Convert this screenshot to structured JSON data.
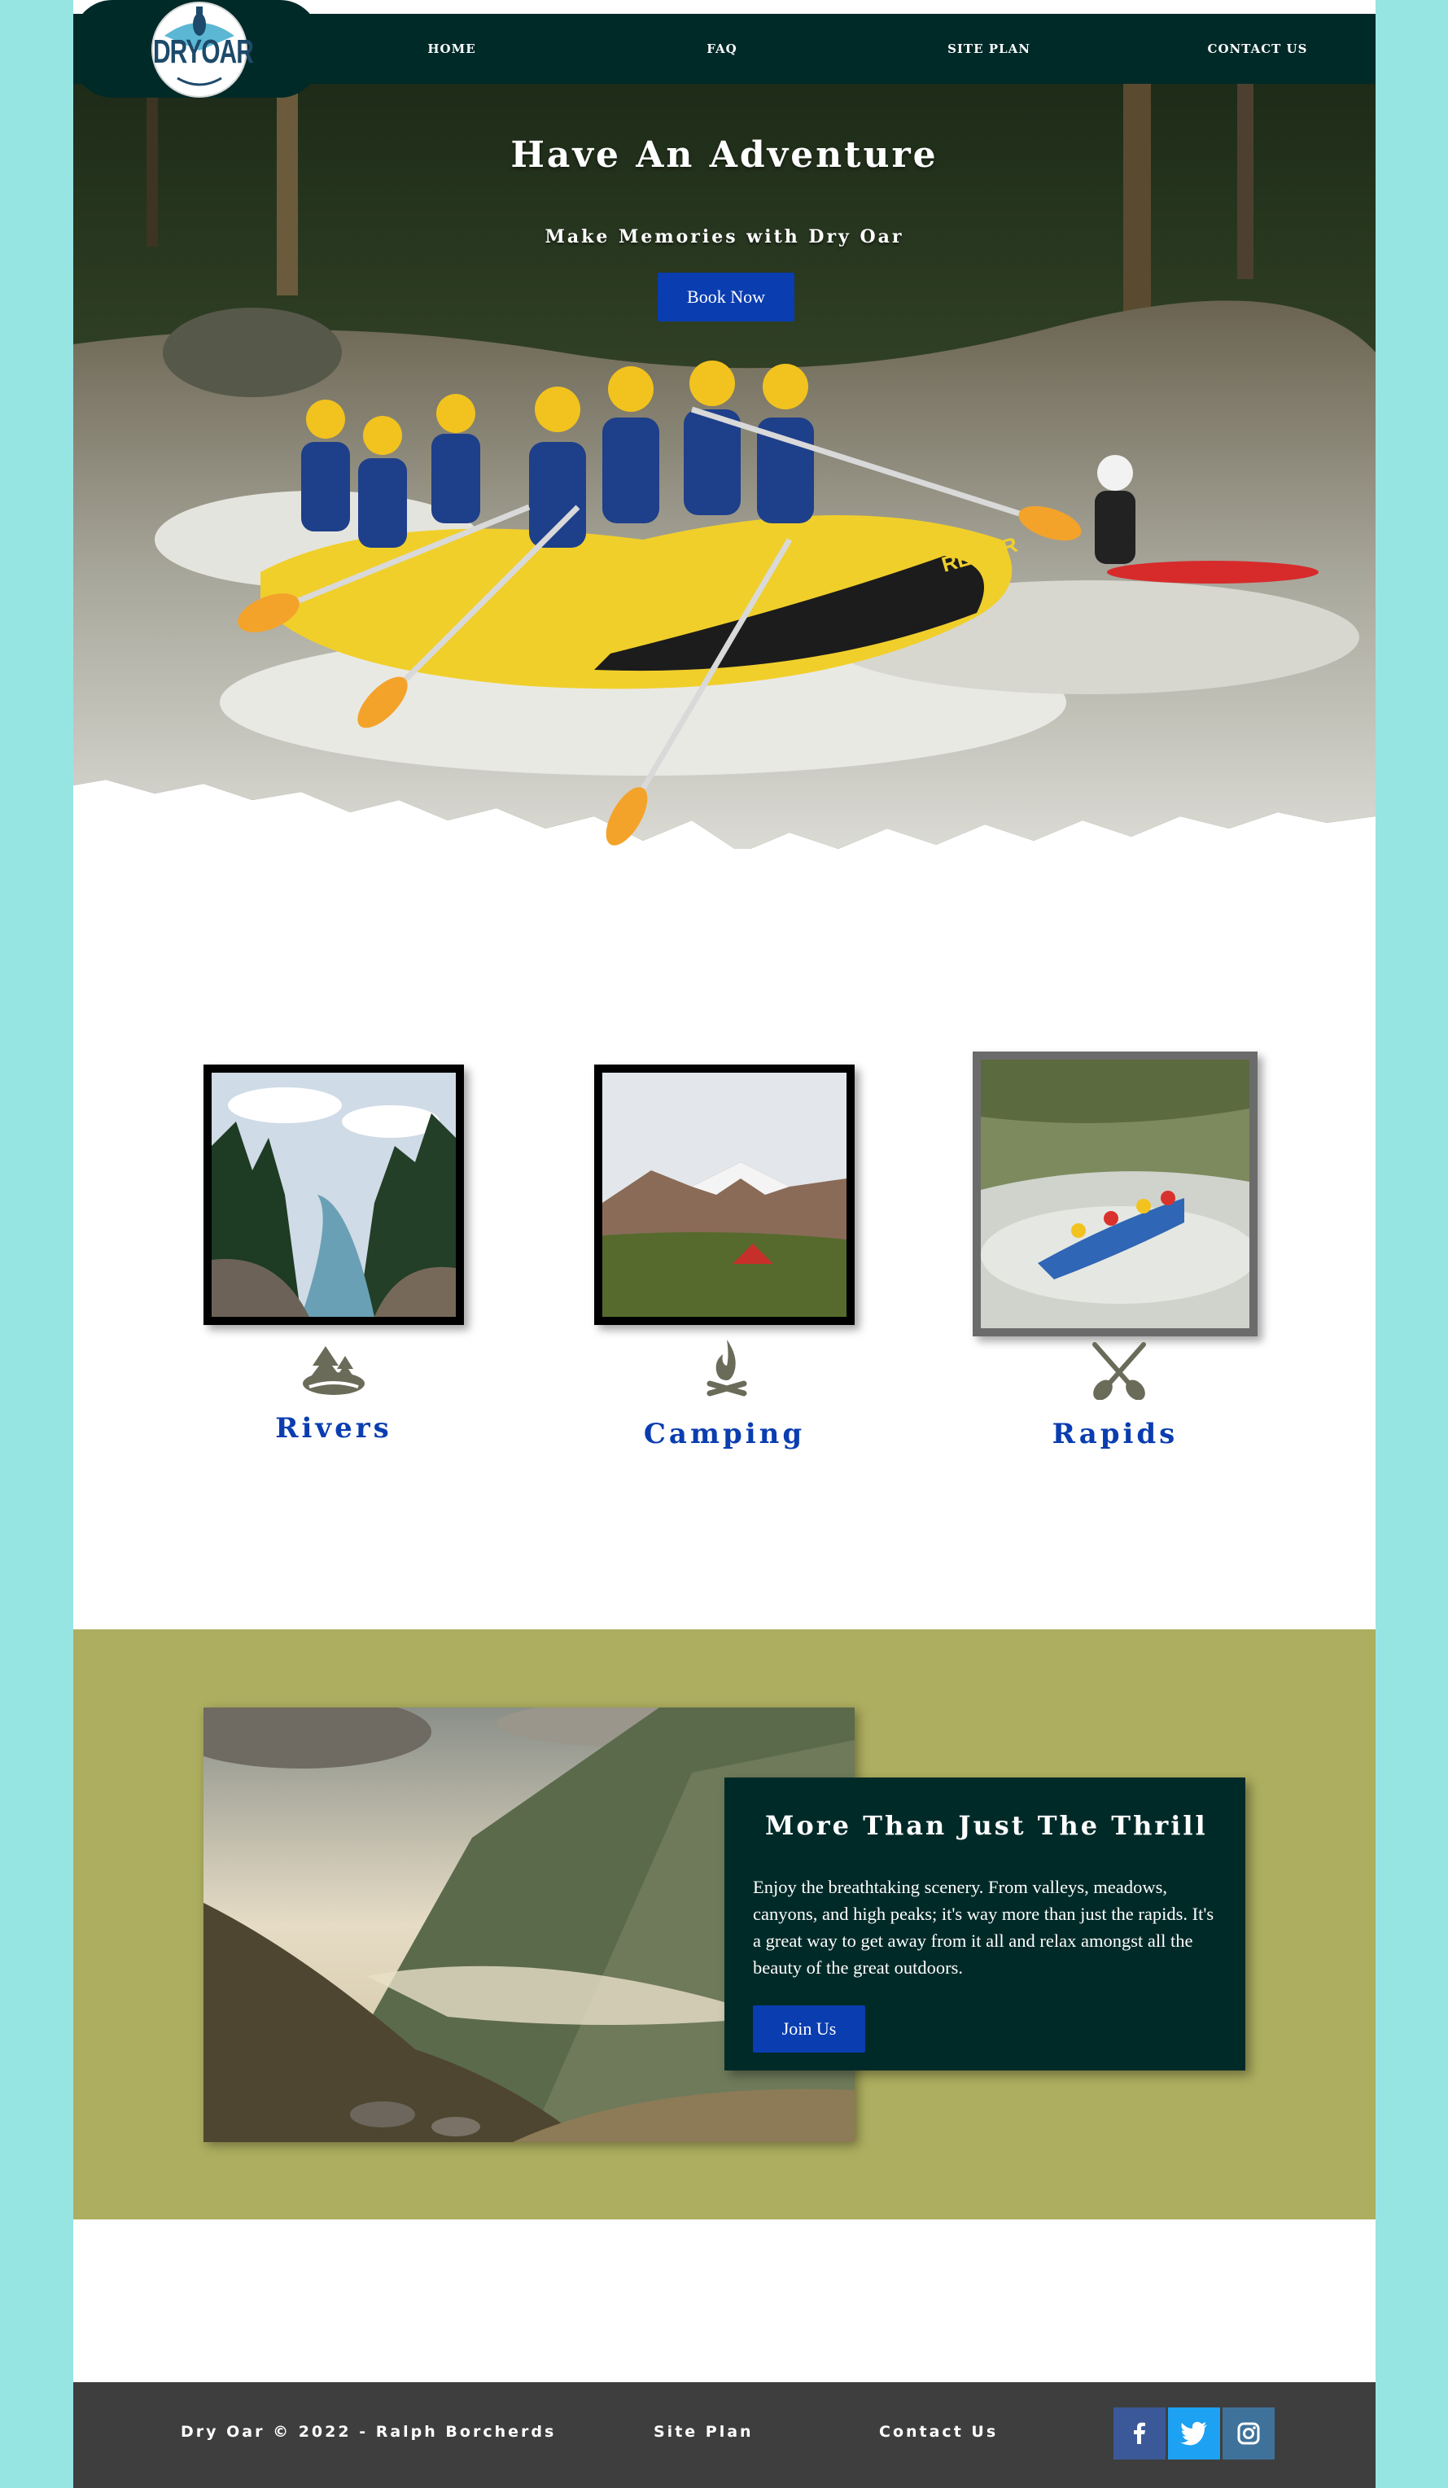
{
  "header": {
    "logo_text": "DRYOAR",
    "nav": [
      {
        "label": "HOME"
      },
      {
        "label": "FAQ"
      },
      {
        "label": "SITE PLAN"
      },
      {
        "label": "CONTACT US"
      }
    ]
  },
  "hero": {
    "title": "Have An Adventure",
    "subtitle": "Make Memories with Dry Oar",
    "cta_label": "Book Now",
    "raft_text": "REMAR"
  },
  "features": [
    {
      "label": "Rivers",
      "icon": "trees-river-icon"
    },
    {
      "label": "Camping",
      "icon": "campfire-icon"
    },
    {
      "label": "Rapids",
      "icon": "crossed-paddles-icon"
    }
  ],
  "thrill": {
    "title": "More Than Just The Thrill",
    "body": "Enjoy the breathtaking scenery. From valleys, meadows, canyons, and high peaks; it's way more than just the rapids. It's a great way to get away from it all and relax amongst all the beauty of the great outdoors.",
    "cta_label": "Join Us"
  },
  "footer": {
    "copyright": "Dry Oar © 2022 - Ralph Borcherds",
    "site_plan": "Site Plan",
    "contact": "Contact Us",
    "social": [
      {
        "icon": "facebook-icon",
        "glyph": "f",
        "color": "#3b5998"
      },
      {
        "icon": "twitter-icon",
        "glyph": "t",
        "color": "#1da1f2"
      },
      {
        "icon": "instagram-icon",
        "glyph": "ig",
        "color": "#3f729b"
      }
    ]
  },
  "colors": {
    "background": "#97e5e3",
    "nav_bg": "#002a28",
    "accent_blue": "#0a3db0",
    "olive": "#adae5f",
    "footer_bg": "#3e3e3e",
    "icon_grey": "#6b6b5a"
  }
}
